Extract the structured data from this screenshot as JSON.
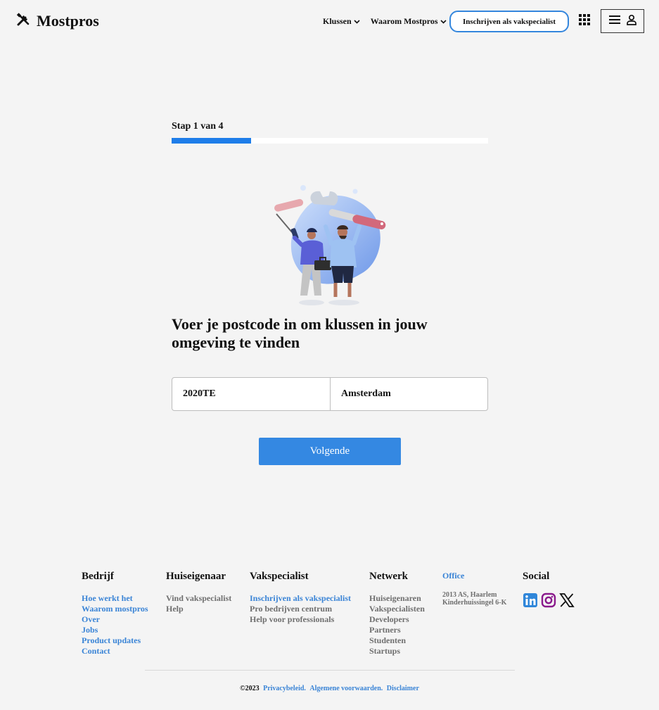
{
  "header": {
    "logo_text": "Mostpros",
    "nav": [
      {
        "label": "Klussen"
      },
      {
        "label": "Waarom Mostpros"
      }
    ],
    "register_label": "Inschrijven als vakspecialist",
    "icons": [
      "tools-icon",
      "chevron-down-icon",
      "apps-grid-icon",
      "menu-icon",
      "user-icon"
    ]
  },
  "step": {
    "label": "Stap 1 van 4",
    "progress": 0.25,
    "accent": "#1e7de9"
  },
  "main": {
    "heading": "Voer je postcode in om klussen in jouw omgeving te vinden",
    "postcode_value": "2020TE",
    "city_value": "Amsterdam",
    "next_label": "Volgende",
    "button_color": "#3488e2"
  },
  "footer": {
    "columns": [
      {
        "title": "Bedrijf",
        "links": [
          "Hoe werkt het",
          "Waarom mostpros",
          "Over",
          "Jobs",
          "Product updates",
          "Contact"
        ]
      },
      {
        "title": "Huiseigenaar",
        "links": [
          "Vind vakspecialist",
          "Help"
        ]
      },
      {
        "title": "Vakspecialist",
        "links": [
          "Inschrijven als vakspecialist",
          "Pro bedrijven centrum",
          "Help voor professionals"
        ]
      },
      {
        "title": "Netwerk",
        "links": [
          "Huiseigenaren",
          "Vakspecialisten",
          "Developers",
          "Partners",
          "Studenten",
          "Startups"
        ]
      }
    ],
    "office": {
      "title": "Office",
      "address_line1": "2013 AS, Haarlem",
      "address_line2": "Kinderhuissingel 6-K"
    },
    "social": {
      "title": "Social",
      "icons": [
        "linkedin-icon",
        "instagram-icon",
        "x-icon"
      ]
    },
    "copyright": "©2023",
    "legal_links": [
      "Privacybeleid.",
      "Algemene voorwaarden.",
      "Disclaimer"
    ]
  }
}
